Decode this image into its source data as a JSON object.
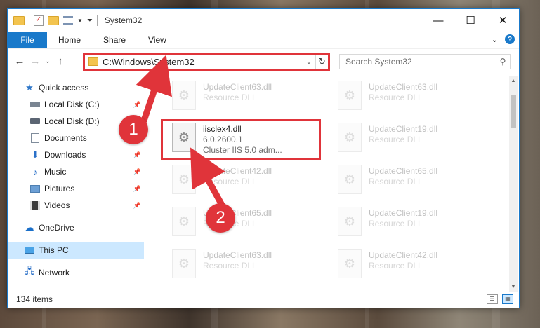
{
  "window": {
    "title": "System32",
    "controls": {
      "minimize": "—",
      "maximize": "☐",
      "close": "✕"
    }
  },
  "ribbon": {
    "tabs": [
      "File",
      "Home",
      "Share",
      "View"
    ],
    "help": "?"
  },
  "nav": {
    "back": "←",
    "forward": "→",
    "recent": "⌄",
    "up": "↑",
    "address": "C:\\Windows\\System32",
    "refresh": "↻",
    "search_placeholder": "Search System32"
  },
  "sidebar": {
    "items": [
      {
        "label": "Quick access",
        "icon": "star-icon"
      },
      {
        "label": "Local Disk (C:)",
        "icon": "drive-icon",
        "pinned": true
      },
      {
        "label": "Local Disk (D:)",
        "icon": "drive-icon"
      },
      {
        "label": "Documents",
        "icon": "documents-icon",
        "pinned": true
      },
      {
        "label": "Downloads",
        "icon": "downloads-icon",
        "pinned": true
      },
      {
        "label": "Music",
        "icon": "music-icon",
        "pinned": true
      },
      {
        "label": "Pictures",
        "icon": "pictures-icon",
        "pinned": true
      },
      {
        "label": "Videos",
        "icon": "videos-icon",
        "pinned": true
      },
      {
        "label": "OneDrive",
        "icon": "cloud-icon"
      },
      {
        "label": "This PC",
        "icon": "computer-icon",
        "selected": true
      },
      {
        "label": "Network",
        "icon": "network-icon"
      }
    ]
  },
  "files": {
    "left": [
      {
        "name": "UpdateClient63.dll",
        "sub": "Resource DLL"
      },
      {
        "name": "iisclex4.dll",
        "sub": "6.0.2600.1",
        "sub2": "Cluster IIS 5.0 adm...",
        "highlighted": true
      },
      {
        "name": "UpdateClient42.dll",
        "sub": "Resource DLL"
      },
      {
        "name": "UpdateClient65.dll",
        "sub": "Resource DLL"
      },
      {
        "name": "UpdateClient63.dll",
        "sub": "Resource DLL"
      }
    ],
    "right": [
      {
        "name": "UpdateClient63.dll",
        "sub": "Resource DLL"
      },
      {
        "name": "UpdateClient19.dll",
        "sub": "Resource DLL"
      },
      {
        "name": "UpdateClient65.dll",
        "sub": "Resource DLL"
      },
      {
        "name": "UpdateClient19.dll",
        "sub": "Resource DLL"
      },
      {
        "name": "UpdateClient42.dll",
        "sub": "Resource DLL"
      }
    ]
  },
  "status": {
    "count": "134 items"
  },
  "callouts": {
    "one": "1",
    "two": "2"
  },
  "colors": {
    "accent": "#1979ca",
    "highlight": "#e0343a",
    "selected": "#cce8ff"
  }
}
